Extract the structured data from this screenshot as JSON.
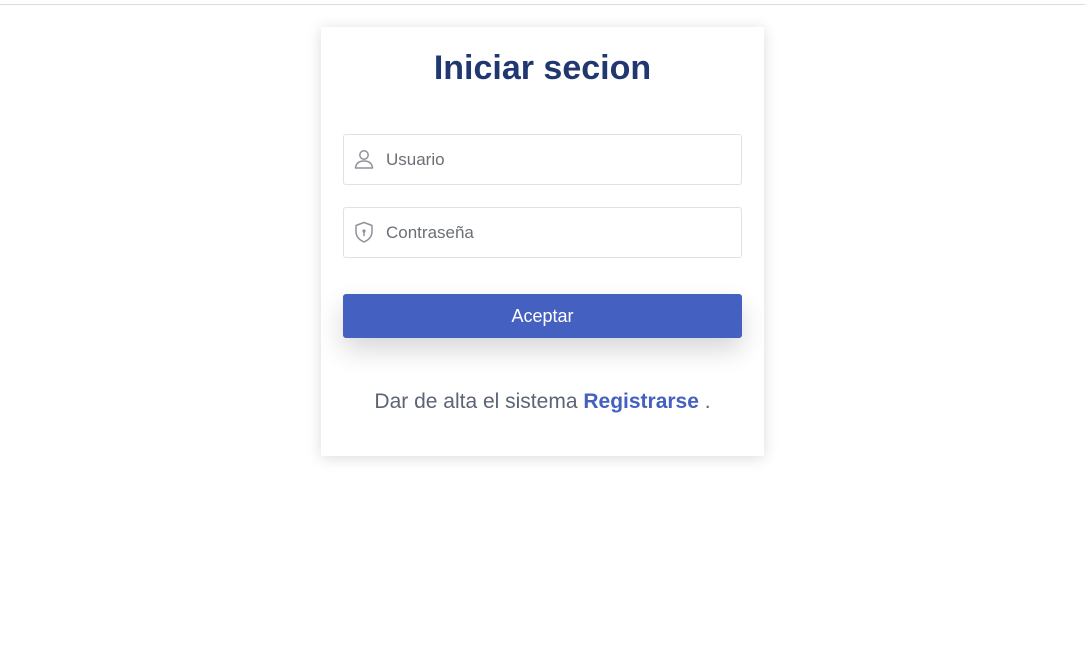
{
  "login": {
    "title": "Iniciar secion",
    "username": {
      "placeholder": "Usuario",
      "value": "",
      "icon": "user-icon"
    },
    "password": {
      "placeholder": "Contraseña",
      "value": "",
      "icon": "shield-lock-icon"
    },
    "submit_label": "Aceptar",
    "signup_text": "Dar de alta el sistema",
    "signup_link": "Registrarse",
    "signup_suffix": "."
  },
  "colors": {
    "title": "#213770",
    "accent": "#4460c0",
    "muted_text": "#5b6475",
    "border": "#dfe2e6"
  }
}
